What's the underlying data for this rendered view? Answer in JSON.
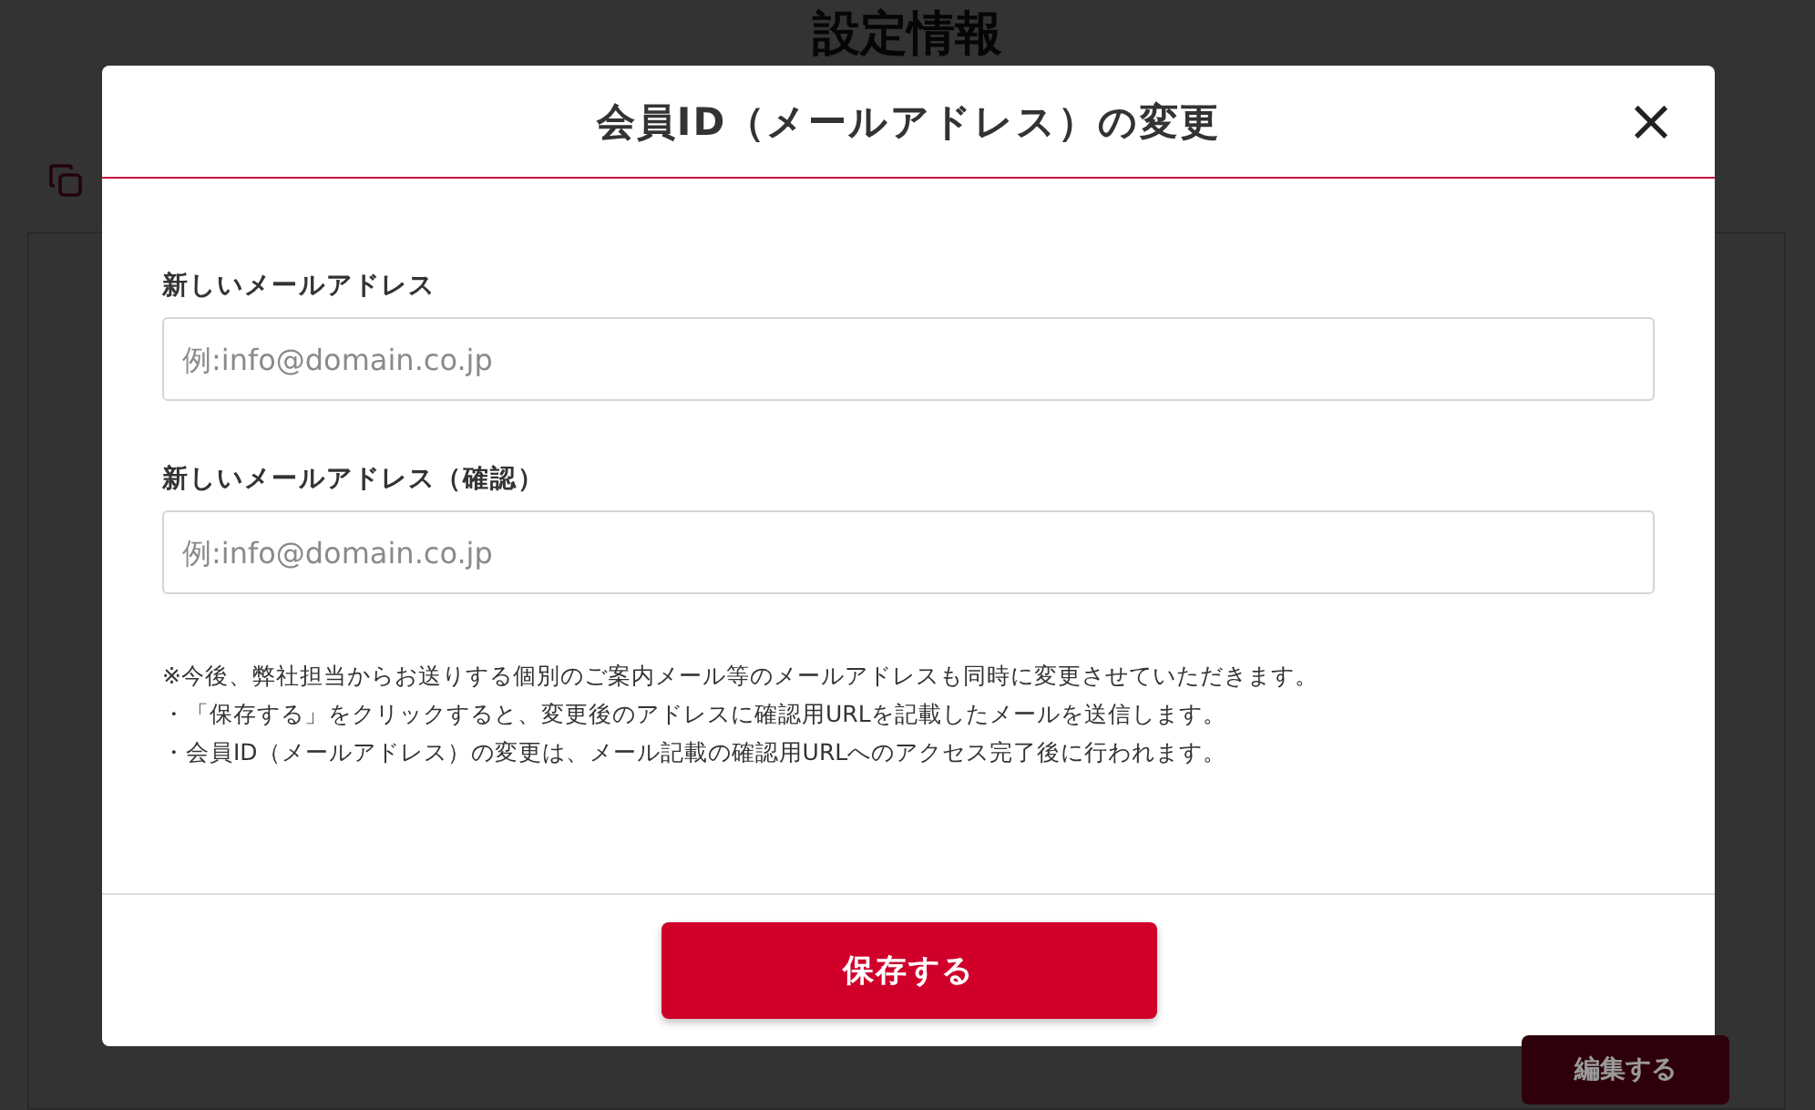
{
  "page": {
    "title": "設定情報",
    "edit_button": "編集する"
  },
  "dialog": {
    "title": "会員ID（メールアドレス）の変更",
    "close": "×",
    "fields": [
      {
        "label": "新しいメールアドレス",
        "placeholder": "例:info@domain.co.jp"
      },
      {
        "label": "新しいメールアドレス（確認）",
        "placeholder": "例:info@domain.co.jp"
      }
    ],
    "notes": [
      "※今後、弊社担当からお送りする個別のご案内メール等のメールアドレスも同時に変更させていただきます。",
      "・「保存する」をクリックすると、変更後のアドレスに確認用URLを記載したメールを送信します。",
      "・会員ID（メールアドレス）の変更は、メール記載の確認用URLへのアクセス完了後に行われます。"
    ],
    "save_button": "保存する"
  }
}
